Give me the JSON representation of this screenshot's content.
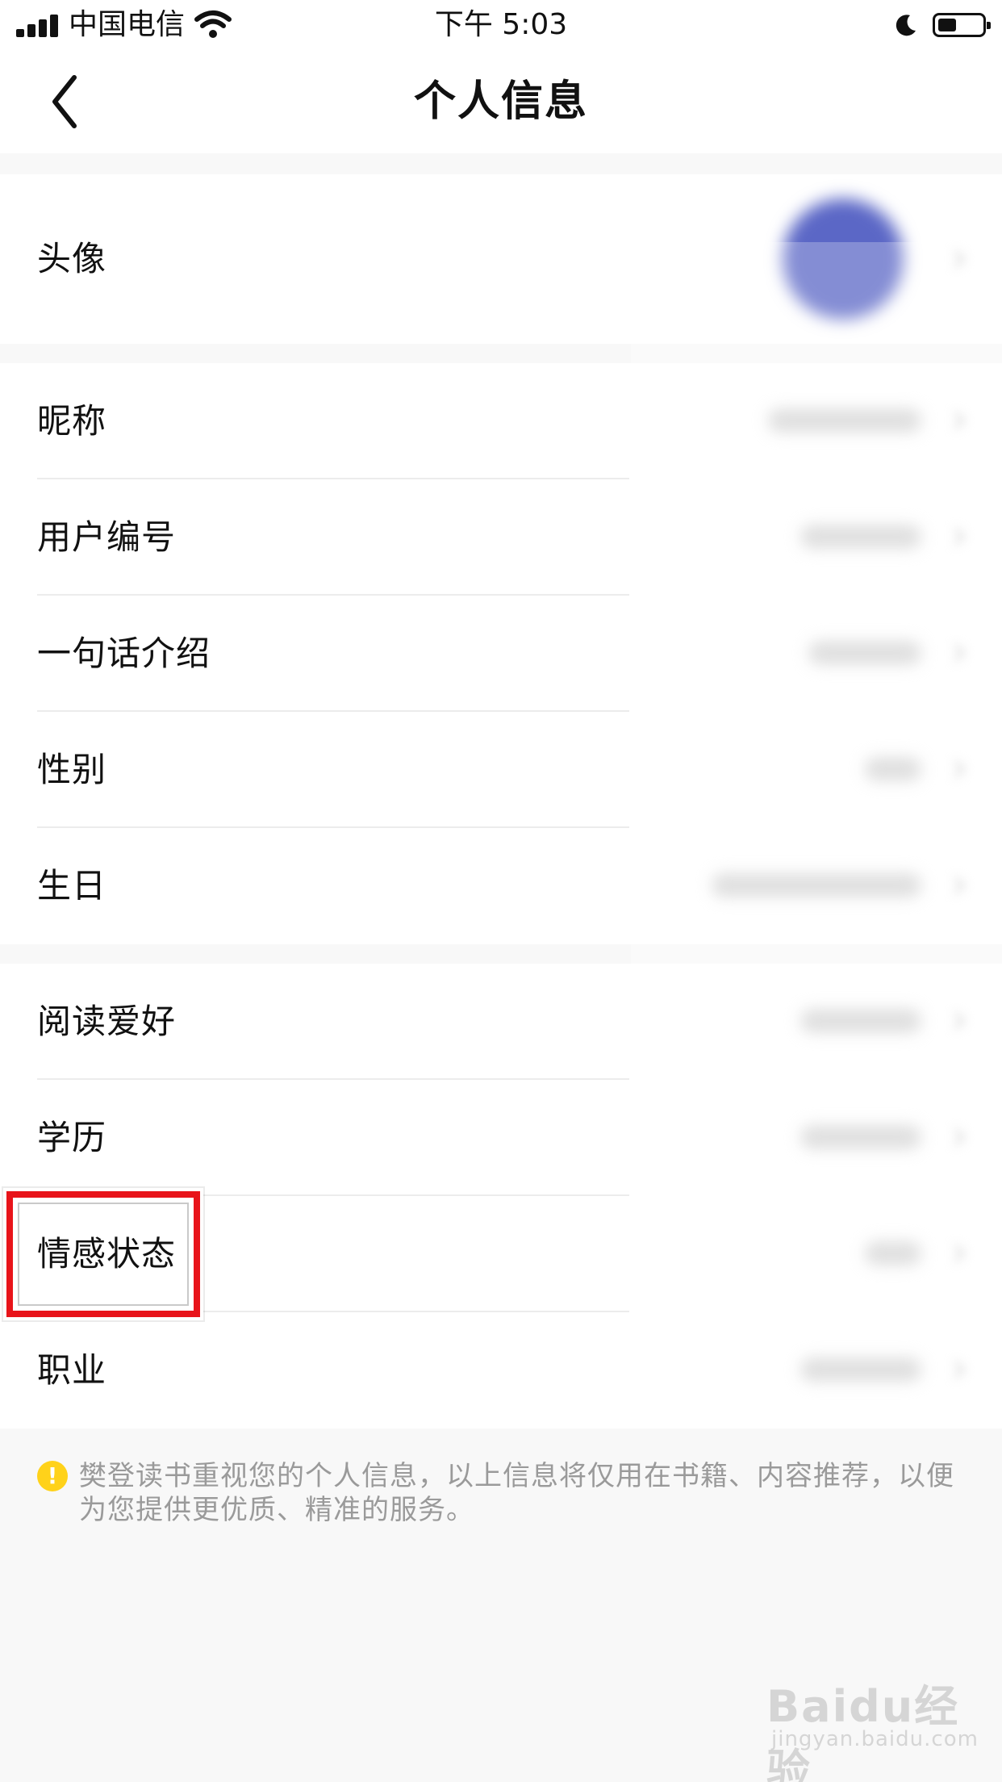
{
  "status_bar": {
    "carrier": "中国电信",
    "time": "下午 5:03"
  },
  "nav": {
    "title": "个人信息"
  },
  "profile": {
    "avatar_label": "头像"
  },
  "section_basic": [
    {
      "label": "昵称"
    },
    {
      "label": "用户编号"
    },
    {
      "label": "一句话介绍"
    },
    {
      "label": "性别"
    },
    {
      "label": "生日"
    }
  ],
  "section_more": [
    {
      "label": "阅读爱好"
    },
    {
      "label": "学历"
    },
    {
      "label": "情感状态"
    },
    {
      "label": "职业"
    }
  ],
  "notice": {
    "icon": "!",
    "text": "樊登读书重视您的个人信息，以上信息将仅用在书籍、内容推荐，以便为您提供更优质、精准的服务。"
  },
  "watermark": {
    "main": "Baidu经验",
    "sub": "jingyan.baidu.com"
  },
  "colors": {
    "highlight": "#e8141a",
    "notice_icon": "#ffd21a",
    "avatar": "#5b67c6"
  }
}
